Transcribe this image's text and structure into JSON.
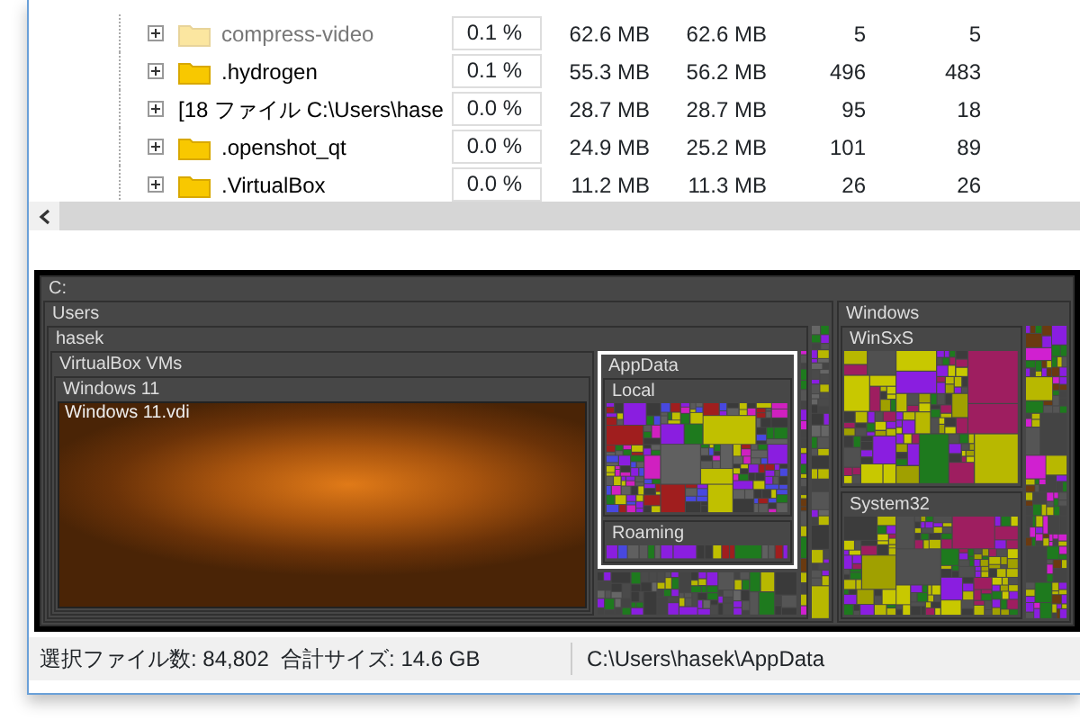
{
  "tree_rows": [
    {
      "kind": "folder",
      "name": "compress-video",
      "dimmed": true,
      "percent": "0.1 %",
      "column_3": "62.6 MB",
      "column_4": "62.6 MB",
      "column_5": "5",
      "column_6": "5"
    },
    {
      "kind": "folder",
      "name": ".hydrogen",
      "dimmed": false,
      "percent": "0.1 %",
      "column_3": "55.3 MB",
      "column_4": "56.2 MB",
      "column_5": "496",
      "column_6": "483"
    },
    {
      "kind": "files",
      "name": "[18 ファイル C:\\Users\\hase",
      "dimmed": false,
      "percent": "0.0 %",
      "column_3": "28.7 MB",
      "column_4": "28.7 MB",
      "column_5": "95",
      "column_6": "18"
    },
    {
      "kind": "folder",
      "name": ".openshot_qt",
      "dimmed": false,
      "percent": "0.0 %",
      "column_3": "24.9 MB",
      "column_4": "25.2 MB",
      "column_5": "101",
      "column_6": "89"
    },
    {
      "kind": "folder",
      "name": ".VirtualBox",
      "dimmed": false,
      "percent": "0.0 %",
      "column_3": "11.2 MB",
      "column_4": "11.3 MB",
      "column_5": "26",
      "column_6": "26"
    }
  ],
  "treemap": {
    "label": "C:",
    "selected": false,
    "children": [
      {
        "label": "Users",
        "selected": false,
        "children": [
          {
            "label": "hasek",
            "selected": false,
            "children": [
              {
                "label": "VirtualBox VMs",
                "selected": false,
                "children": [
                  {
                    "label": "Windows 11",
                    "selected": false,
                    "children": [
                      {
                        "label": "Windows 11.vdi",
                        "selected": false
                      }
                    ]
                  }
                ]
              },
              {
                "label": "AppData",
                "selected": true,
                "children": [
                  {
                    "label": "Local",
                    "selected": false
                  },
                  {
                    "label": "Roaming",
                    "selected": false
                  }
                ]
              }
            ]
          }
        ]
      },
      {
        "label": "Windows",
        "selected": false,
        "children": [
          {
            "label": "WinSxS",
            "selected": false
          },
          {
            "label": "System32",
            "selected": false
          }
        ]
      }
    ]
  },
  "status_bar": {
    "selection": "選択ファイル数: 84,802  合計サイズ: 14.6 GB",
    "path": "C:\\Users\\hasek\\AppData"
  }
}
